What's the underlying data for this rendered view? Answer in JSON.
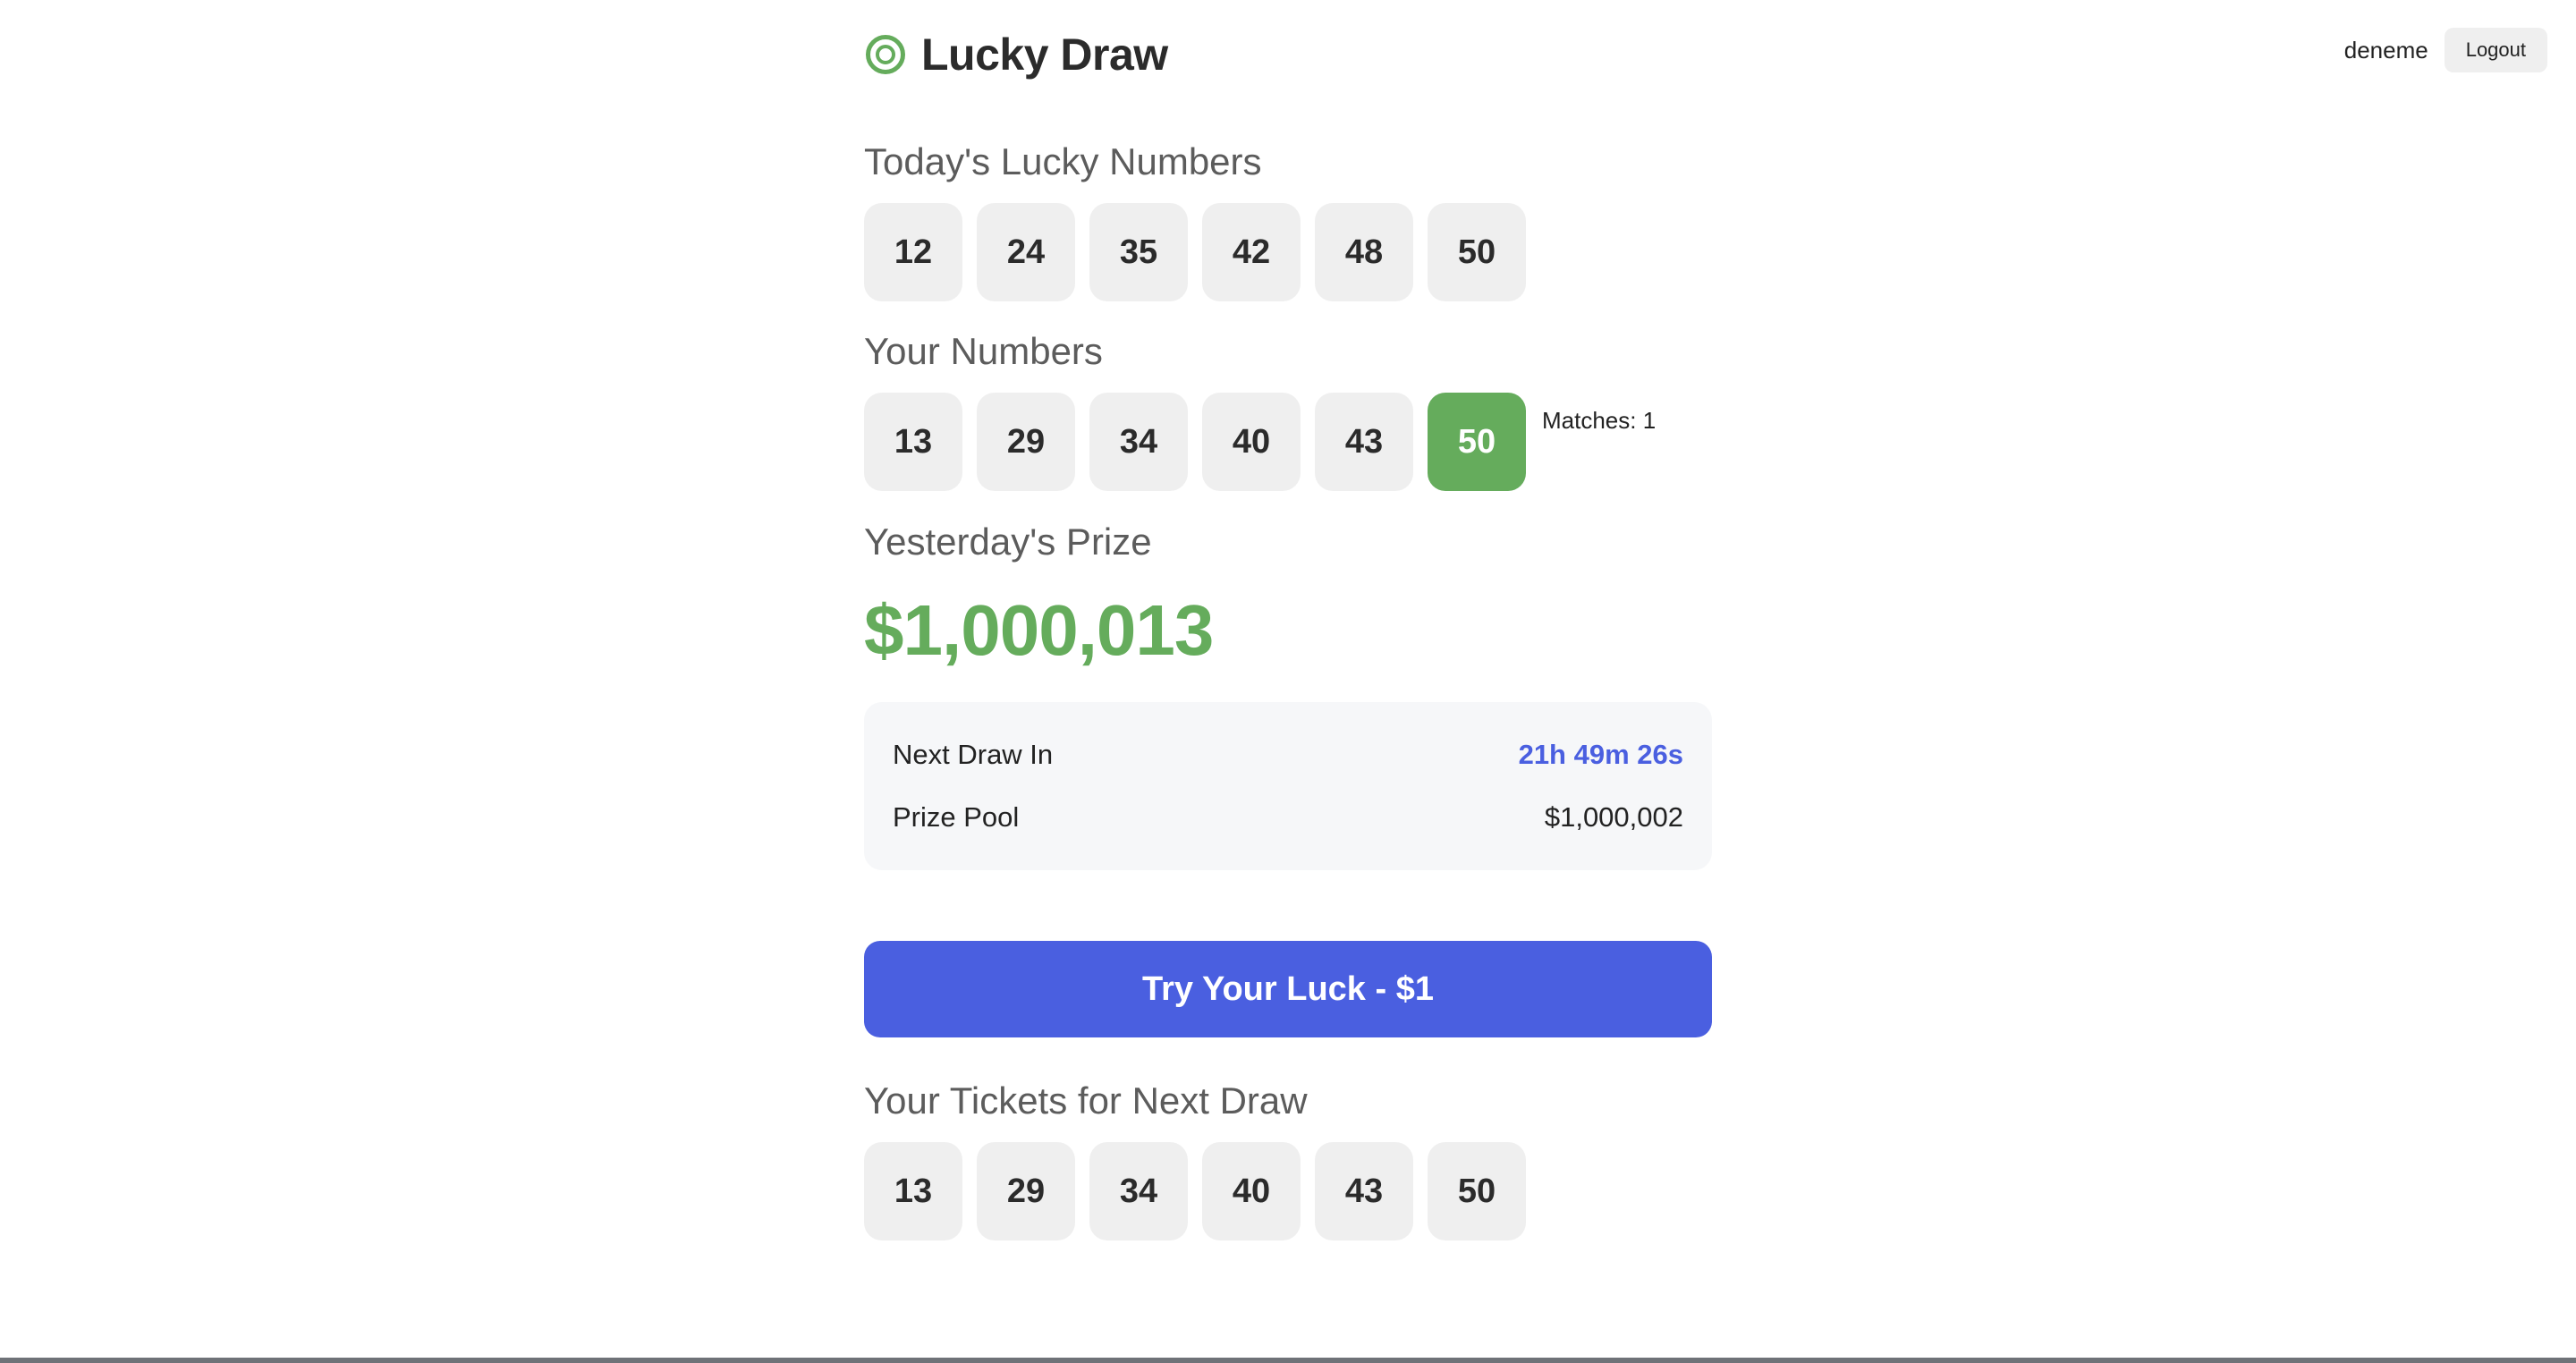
{
  "header": {
    "brand_title": "Lucky Draw",
    "brand_icon": "target-icon",
    "username": "deneme",
    "logout_label": "Logout"
  },
  "todays_numbers": {
    "title": "Today's Lucky Numbers",
    "numbers": [
      "12",
      "24",
      "35",
      "42",
      "48",
      "50"
    ]
  },
  "your_numbers": {
    "title": "Your Numbers",
    "numbers": [
      "13",
      "29",
      "34",
      "40",
      "43",
      "50"
    ],
    "matched_numbers": [
      "50"
    ],
    "matches_label": "Matches: 1"
  },
  "yesterday": {
    "title": "Yesterday's Prize",
    "prize": "$1,000,013"
  },
  "info": {
    "next_draw_label": "Next Draw In",
    "next_draw_value": "21h 49m 26s",
    "prize_pool_label": "Prize Pool",
    "prize_pool_value": "$1,000,002"
  },
  "cta": {
    "label": "Try Your Luck - $1"
  },
  "tickets": {
    "title": "Your Tickets for Next Draw",
    "numbers": [
      "13",
      "29",
      "34",
      "40",
      "43",
      "50"
    ]
  },
  "colors": {
    "accent_green": "#65ac5c",
    "accent_blue": "#4a5fe0",
    "ball_bg": "#efefef"
  }
}
